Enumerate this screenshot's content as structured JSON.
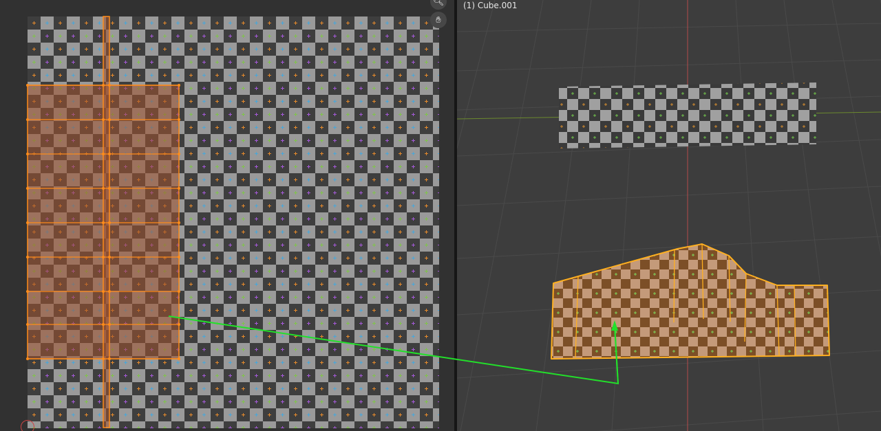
{
  "viewport": {
    "object_label": "(1) Cube.001"
  },
  "icons": {
    "zoom": "magnifier-icon",
    "pan": "hand-icon"
  },
  "colors": {
    "checker_light": "#9a9a9a",
    "checker_dark": "#3e3e3e",
    "selection_fill": "#a0522d",
    "selection_edge": "#ff8c1a",
    "viewport_bg": "#3d3d3d",
    "grid_line": "#4a4a4a",
    "x_axis": "#b44a4a",
    "y_axis": "#6c8a2e",
    "annotation_arrow": "#22e02a",
    "mesh_outline": "#ffb020"
  }
}
